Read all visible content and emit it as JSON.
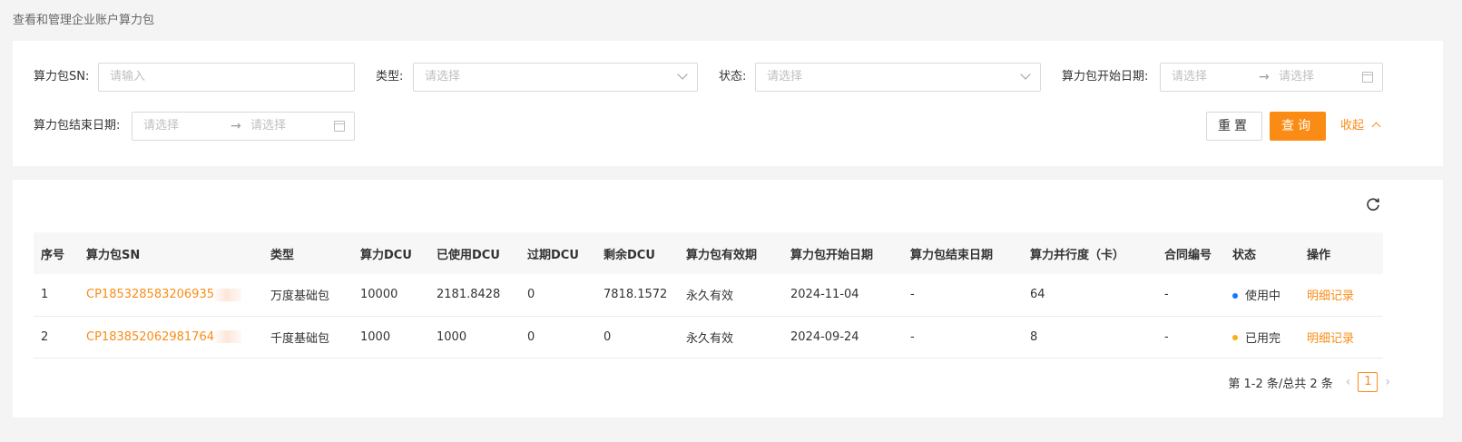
{
  "page": {
    "description": "查看和管理企业账户算力包"
  },
  "filters": {
    "sn_label": "算力包SN",
    "sn_placeholder": "请输入",
    "type_label": "类型",
    "type_placeholder": "请选择",
    "status_label": "状态",
    "status_placeholder": "请选择",
    "start_label": "算力包开始日期",
    "end_label": "算力包结束日期",
    "range_start_placeholder": "请选择",
    "range_end_placeholder": "请选择",
    "colon": ":",
    "reset_label": "重置",
    "query_label": "查询",
    "collapse_label": "收起"
  },
  "table": {
    "columns": [
      "序号",
      "算力包SN",
      "类型",
      "算力DCU",
      "已使用DCU",
      "过期DCU",
      "剩余DCU",
      "算力包有效期",
      "算力包开始日期",
      "算力包结束日期",
      "算力并行度（卡）",
      "合同编号",
      "状态",
      "操作"
    ],
    "rows": [
      {
        "index": "1",
        "sn": "CP185328583206935",
        "type": "万度基础包",
        "dcu": "10000",
        "used": "2181.8428",
        "expired": "0",
        "remaining": "7818.1572",
        "validity": "永久有效",
        "start": "2024-11-04",
        "end": "-",
        "parallel": "64",
        "contract": "-",
        "status": "使用中",
        "status_color": "#1677ff",
        "action": "明细记录"
      },
      {
        "index": "2",
        "sn": "CP183852062981764",
        "type": "千度基础包",
        "dcu": "1000",
        "used": "1000",
        "expired": "0",
        "remaining": "0",
        "validity": "永久有效",
        "start": "2024-09-24",
        "end": "-",
        "parallel": "8",
        "contract": "-",
        "status": "已用完",
        "status_color": "#faad14",
        "action": "明细记录"
      }
    ]
  },
  "pagination": {
    "summary": "第 1-2 条/总共 2 条",
    "current": "1"
  },
  "colors": {
    "accent": "#fa8c16"
  }
}
